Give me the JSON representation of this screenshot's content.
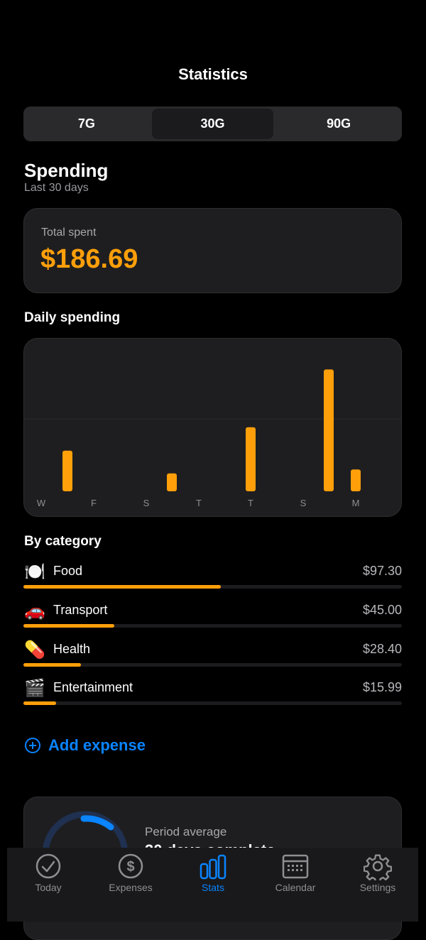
{
  "header": {
    "title": "Statistics"
  },
  "period_selector": {
    "options": [
      "7G",
      "30G",
      "90G"
    ],
    "selected": "30G"
  },
  "spending": {
    "title": "Spending",
    "subtitle": "Last 30 days"
  },
  "total": {
    "label": "Total spent",
    "value": "$186.69"
  },
  "daily": {
    "title": "Daily spending",
    "chart_data": {
      "type": "bar",
      "x_labels": [
        "W",
        "F",
        "S",
        "T",
        "T",
        "S",
        "M"
      ],
      "values": [
        26.0,
        11.5,
        41.0,
        78.0,
        14.0
      ],
      "grid": "single horizontal line"
    }
  },
  "categories": {
    "title": "By category",
    "items": [
      {
        "emoji": "🍽️",
        "name": "Food",
        "amount": "$97.30",
        "share": 0.521
      },
      {
        "emoji": "🚗",
        "name": "Transport",
        "amount": "$45.00",
        "share": 0.241
      },
      {
        "emoji": "💊",
        "name": "Health",
        "amount": "$28.40",
        "share": 0.152
      },
      {
        "emoji": "🎬",
        "name": "Entertainment",
        "amount": "$15.99",
        "share": 0.086
      }
    ]
  },
  "add_expense": {
    "label": "Add expense",
    "icon": "plus-circle-icon"
  },
  "average": {
    "label": "Period average",
    "value": "30 days complete"
  },
  "tabs": [
    {
      "label": "Today",
      "icon": "checkmark-circle-icon",
      "active": false
    },
    {
      "label": "Expenses",
      "icon": "dollar-circle-icon",
      "active": false
    },
    {
      "label": "Stats",
      "icon": "bar-chart-icon",
      "active": true
    },
    {
      "label": "Calendar",
      "icon": "calendar-icon",
      "active": false
    },
    {
      "label": "Settings",
      "icon": "gear-icon",
      "active": false
    }
  ],
  "colors": {
    "accent": "#ff9f0a",
    "link": "#0a84ff",
    "background": "#000000",
    "card": "#1e1e20"
  }
}
